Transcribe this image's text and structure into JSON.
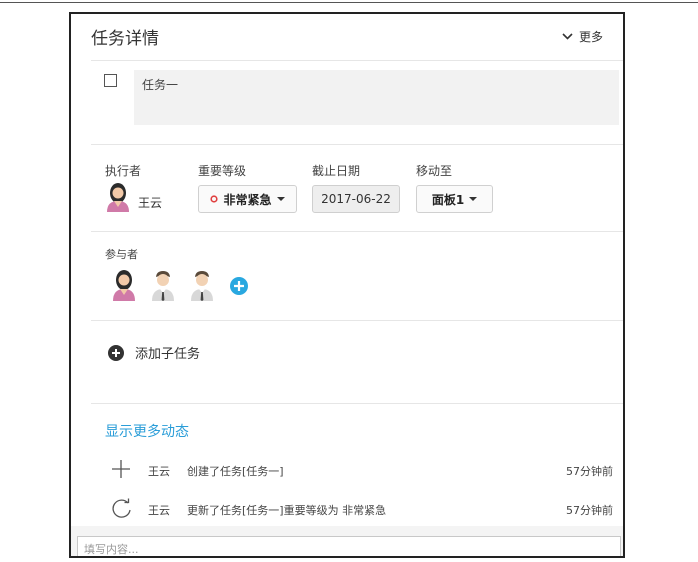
{
  "header": {
    "title": "任务详情",
    "more_label": "更多"
  },
  "task": {
    "title": "任务一"
  },
  "fields": {
    "assignee_label": "执行者",
    "assignee_name": "王云",
    "priority_label": "重要等级",
    "priority_value": "非常紧急",
    "due_label": "截止日期",
    "due_value": "2017-06-22",
    "move_label": "移动至",
    "move_value": "面板1"
  },
  "participants": {
    "label": "参与者"
  },
  "subtask": {
    "add_label": "添加子任务"
  },
  "activity": {
    "show_more": "显示更多动态",
    "items": [
      {
        "icon": "plus-icon",
        "user": "王云",
        "text": "创建了任务[任务一]",
        "time": "57分钟前"
      },
      {
        "icon": "refresh-icon",
        "user": "王云",
        "text": "更新了任务[任务一]重要等级为 非常紧急",
        "time": "57分钟前"
      }
    ]
  },
  "comment": {
    "placeholder": "填写内容..."
  },
  "colors": {
    "link": "#2a9dd8",
    "priority_dot": "#e04040",
    "add_participant": "#29a8e0"
  }
}
